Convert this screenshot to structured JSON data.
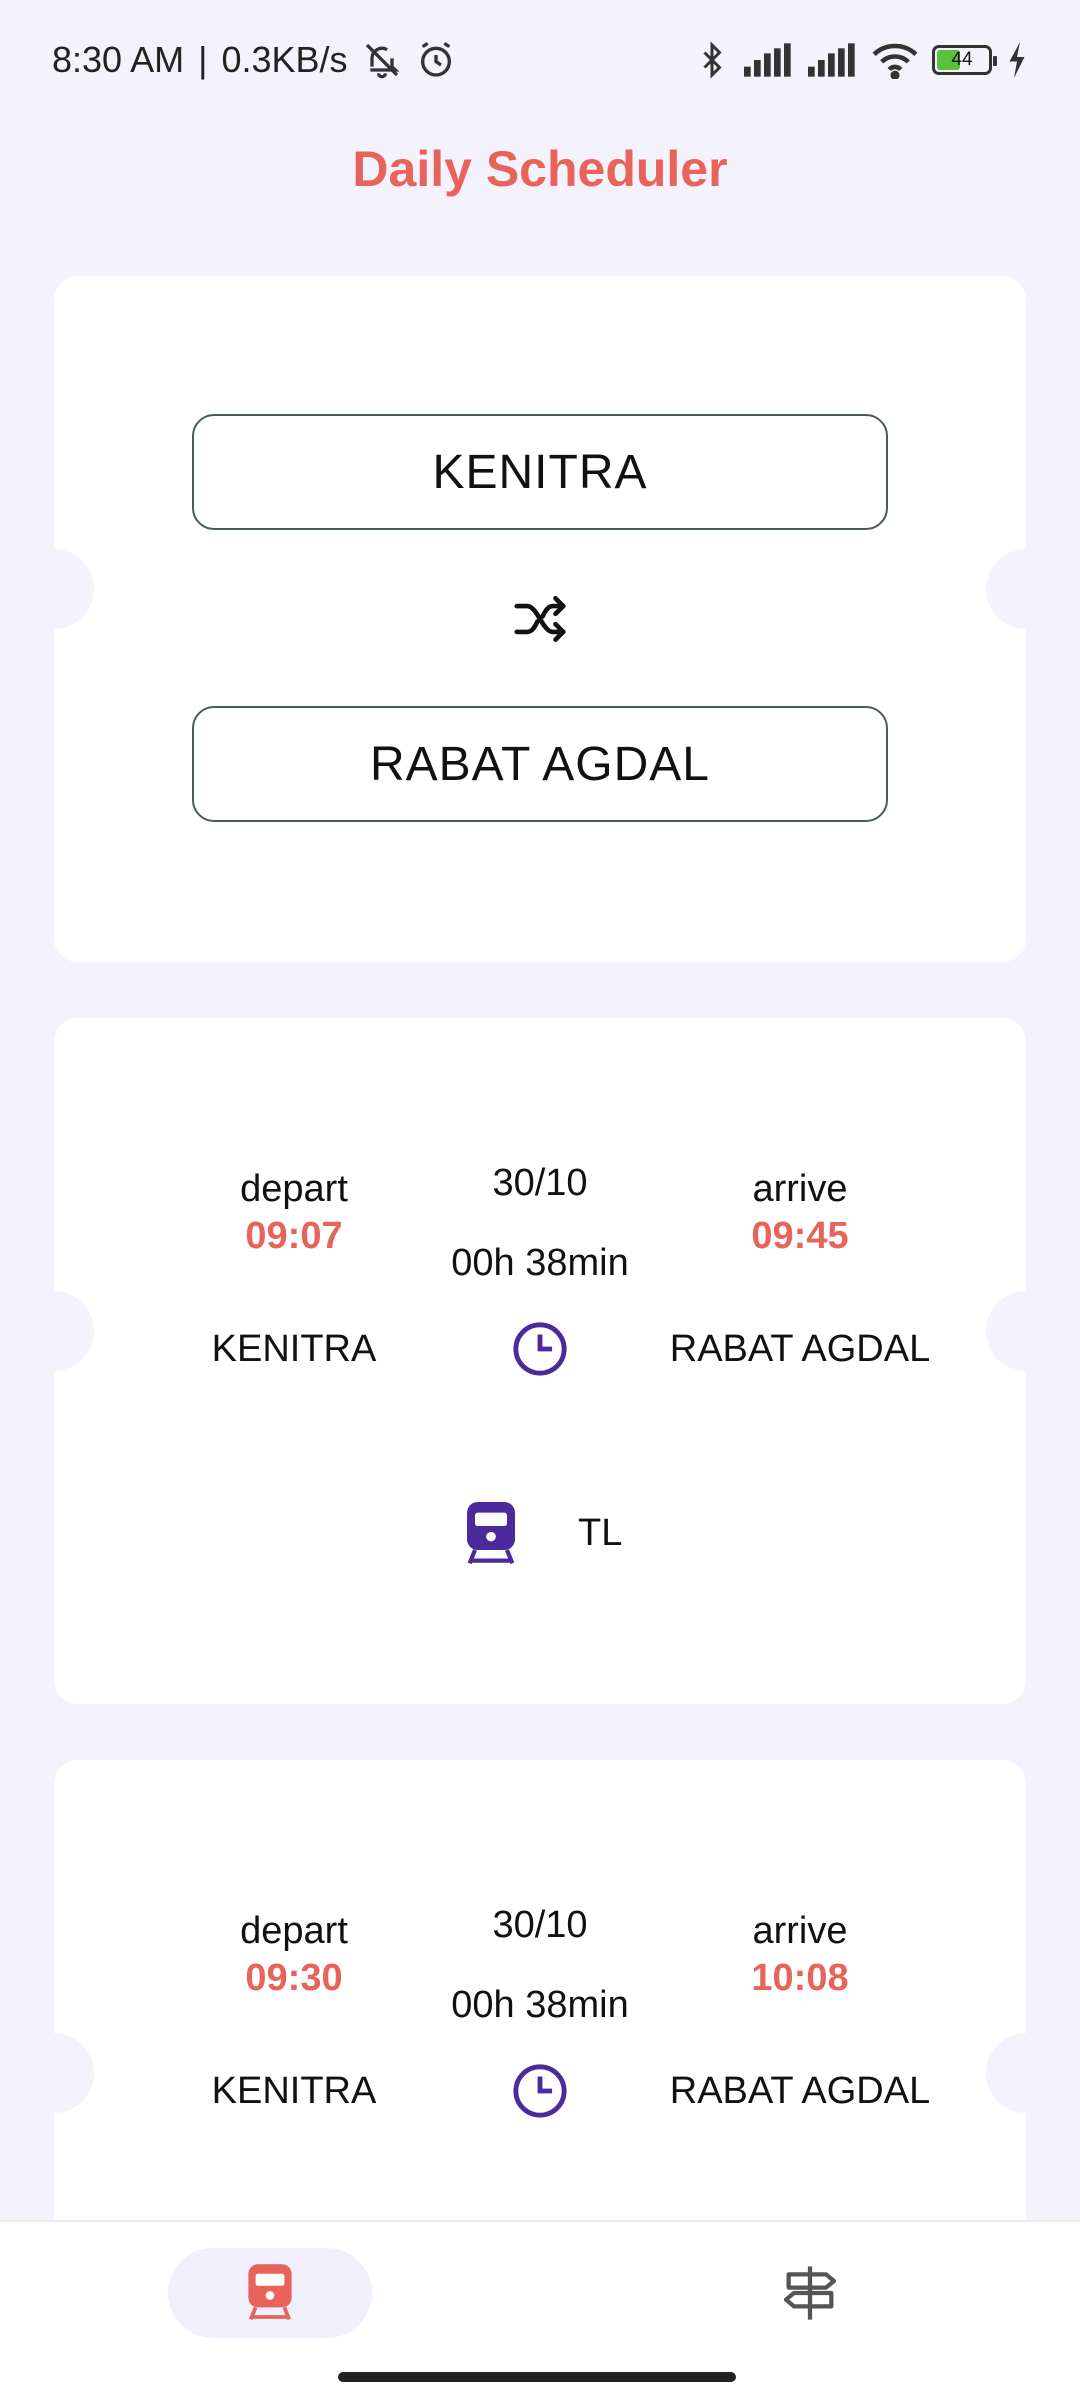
{
  "status_bar": {
    "time": "8:30 AM",
    "speed": "0.3KB/s",
    "battery": "44",
    "icons": [
      "bell-off-icon",
      "alarm-icon",
      "bluetooth-icon",
      "signal-icon",
      "signal-icon",
      "wifi-icon",
      "battery-icon",
      "charging-icon"
    ]
  },
  "app": {
    "title": "Daily Scheduler",
    "accent": "#e8645a",
    "icon_color": "#4b2a9b"
  },
  "selector": {
    "from": "KENITRA",
    "to": "RABAT AGDAL",
    "swap_icon": "shuffle-icon"
  },
  "trips": [
    {
      "depart_label": "depart",
      "depart_time": "09:07",
      "from": "KENITRA",
      "date": "30/10",
      "duration": "00h 38min",
      "arrive_label": "arrive",
      "arrive_time": "09:45",
      "to": "RABAT AGDAL",
      "train_type": "TL"
    },
    {
      "depart_label": "depart",
      "depart_time": "09:30",
      "from": "KENITRA",
      "date": "30/10",
      "duration": "00h 38min",
      "arrive_label": "arrive",
      "arrive_time": "10:08",
      "to": "RABAT AGDAL"
    }
  ],
  "nav": {
    "items": [
      "train-icon",
      "signpost-icon"
    ],
    "active": "train-icon"
  }
}
